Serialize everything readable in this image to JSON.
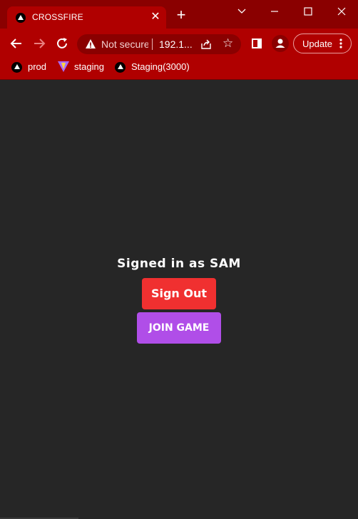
{
  "browser": {
    "tab": {
      "title": "CROSSFIRE",
      "close_glyph": "✕",
      "favicon": "triangle-logo-icon"
    },
    "new_tab_glyph": "+",
    "window_controls": [
      "chevron-down-icon",
      "minimize-icon",
      "maximize-icon",
      "close-icon"
    ],
    "toolbar": {
      "omnibox": {
        "security_label": "Not secure",
        "url": "192.1..."
      },
      "update_label": "Update"
    },
    "bookmarks": [
      {
        "label": "prod",
        "icon": "triangle-logo-icon"
      },
      {
        "label": "staging",
        "icon": "vite-logo-icon"
      },
      {
        "label": "Staging(3000)",
        "icon": "triangle-logo-icon"
      }
    ],
    "colors": {
      "chrome": "#b00000",
      "tabstrip": "#8a0000"
    }
  },
  "page": {
    "status_text": "Signed in as SAM",
    "sign_out_label": "Sign Out",
    "join_game_label": "JOIN GAME",
    "colors": {
      "background": "#262626",
      "sign_out": "#f03030",
      "join_game": "#b04ee8"
    }
  }
}
